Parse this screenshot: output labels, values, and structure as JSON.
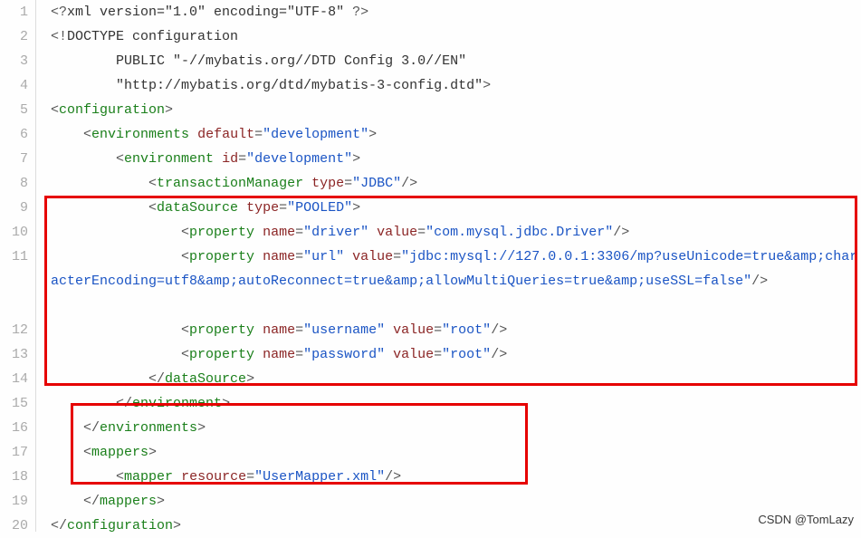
{
  "gutter": [
    "1",
    "2",
    "3",
    "4",
    "5",
    "6",
    "7",
    "8",
    "9",
    "10",
    "11",
    "",
    "",
    "12",
    "13",
    "14",
    "15",
    "16",
    "17",
    "18",
    "19",
    "20"
  ],
  "code": {
    "l1": {
      "pre": "",
      "p1": "<?",
      "txt": "xml version=\"1.0\" encoding=\"UTF-8\" ",
      "p2": "?>"
    },
    "l2": {
      "pre": "",
      "p1": "<!",
      "txt": "DOCTYPE configuration"
    },
    "l3": {
      "pre": "        ",
      "txt": "PUBLIC \"-//mybatis.org//DTD Config 3.0//EN\""
    },
    "l4": {
      "pre": "        ",
      "txt": "\"http://mybatis.org/dtd/mybatis-3-config.dtd\"",
      "p2": ">"
    },
    "l5": {
      "pre": "",
      "tag": "configuration"
    },
    "l6": {
      "pre": "    ",
      "tag": "environments",
      "attr": "default",
      "val": "\"development\""
    },
    "l7": {
      "pre": "        ",
      "tag": "environment",
      "attr": "id",
      "val": "\"development\""
    },
    "l8": {
      "pre": "            ",
      "tag": "transactionManager",
      "attr": "type",
      "val": "\"JDBC\""
    },
    "l9": {
      "pre": "            ",
      "tag": "dataSource",
      "attr": "type",
      "val": "\"POOLED\""
    },
    "l10": {
      "pre": "                ",
      "tag": "property",
      "a1": "name",
      "v1": "\"driver\"",
      "a2": "value",
      "v2": "\"com.mysql.jdbc.Driver\""
    },
    "l11": {
      "pre": "                ",
      "tag": "property",
      "a1": "name",
      "v1": "\"url\"",
      "a2": "value",
      "v2": "\"jdbc:mysql://127.0.0.1:3306/mp?useUnicode=true&amp;characterEncoding=utf8&amp;autoReconnect=true&amp;allowMultiQueries=true&amp;useSSL=false\""
    },
    "l12": {
      "pre": "                ",
      "tag": "property",
      "a1": "name",
      "v1": "\"username\"",
      "a2": "value",
      "v2": "\"root\""
    },
    "l13": {
      "pre": "                ",
      "tag": "property",
      "a1": "name",
      "v1": "\"password\"",
      "a2": "value",
      "v2": "\"root\""
    },
    "l14": {
      "pre": "            ",
      "tag": "dataSource"
    },
    "l15": {
      "pre": "        ",
      "tag": "environment"
    },
    "l16": {
      "pre": "    ",
      "tag": "environments"
    },
    "l17": {
      "pre": "    ",
      "tag": "mappers"
    },
    "l18": {
      "pre": "        ",
      "tag": "mapper",
      "attr": "resource",
      "val": "\"UserMapper.xml\""
    },
    "l19": {
      "pre": "    ",
      "tag": "mappers"
    },
    "l20": {
      "pre": "",
      "tag": "configuration"
    }
  },
  "watermark": {
    "bottom": "CSDN @TomLazy"
  }
}
